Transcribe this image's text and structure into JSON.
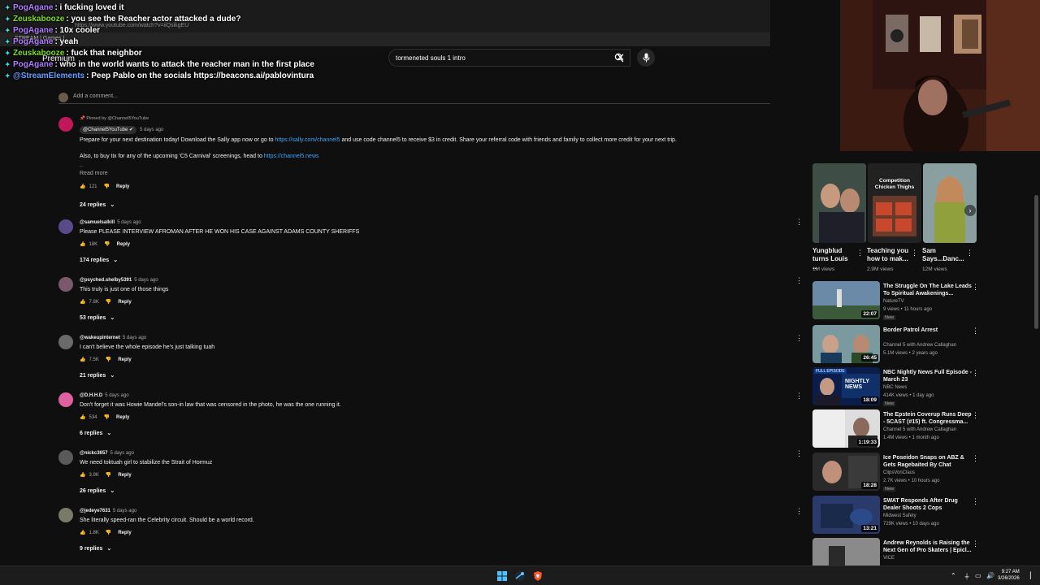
{
  "browser": {
    "url_fragment": "https://www.youtube.com/watch?v=iiQsikgEU",
    "tabs_text": "STREAM   |   Games   |"
  },
  "logo": {
    "premium_label": "Premium"
  },
  "chat": {
    "lines": [
      {
        "user": "PogAgane",
        "msg": ": i fucking loved it",
        "color": "#b07cff"
      },
      {
        "user": "Zeuskabooze",
        "msg": ": you see the Reacher actor attacked a dude?",
        "color": "#7cdc2a"
      },
      {
        "user": "PogAgane",
        "msg": ": 10x cooler",
        "color": "#b07cff"
      },
      {
        "user": "PogAgane",
        "msg": ": yeah",
        "color": "#b07cff"
      },
      {
        "user": "Zeuskabooze",
        "msg": ": fuck that neighbor",
        "color": "#7cdc2a"
      },
      {
        "user": "PogAgane",
        "msg": ": who in the world wants to attack the reacher man in the first place",
        "color": "#b07cff"
      },
      {
        "user": "@StreamElements",
        "msg": ": Peep Pablo on the socials https://beacons.ai/pablovintura",
        "color": "#6aa0ff"
      }
    ]
  },
  "search": {
    "query": "tormeneted souls 1 intro"
  },
  "comments_section": {
    "add_comment_placeholder": "Add a comment...",
    "pinned": {
      "pinned_label": "Pinned by @Channel5YouTube",
      "author": "@Channel5YouTube",
      "time": "5 days ago",
      "text_before_link": "Prepare for your next destination today! Download the Sally app now or go to ",
      "link1": "https://sally.com/channel5",
      "text_after_link": " and use code channel5 to receive $3 in credit. Share your referral code with friends and family to collect more credit for your next trip.",
      "text2_before_link": "Also, to buy tix for any of the upcoming 'C5 Carnival' screenings, head to ",
      "link2": "https://channel5.news",
      "dots": "..",
      "read_more": "Read more",
      "likes": "121",
      "reply": "Reply",
      "replies": "24 replies"
    },
    "comments": [
      {
        "author": "@samuelsalkill",
        "time": "5 days ago",
        "text": "Please PLEASE INTERVIEW AFROMAN AFTER HE WON HIS CASE AGAINST ADAMS COUNTY SHERIFFS",
        "likes": "18K",
        "reply": "Reply",
        "replies": "174 replies"
      },
      {
        "author": "@psyched.shelby5391",
        "time": "5 days ago",
        "text": "This truly is just one of those things",
        "likes": "7.8K",
        "reply": "Reply",
        "replies": "53 replies"
      },
      {
        "author": "@wakeupinternet",
        "time": "5 days ago",
        "text": "I can't believe the whole episode he's just talking tuah",
        "likes": "7.5K",
        "reply": "Reply",
        "replies": "21 replies"
      },
      {
        "author": "@D.H.H.D",
        "time": "5 days ago",
        "text": "Don't forget it was Howie Mandel's son-in law that was censored in the photo, he was the one running it.",
        "likes": "534",
        "reply": "Reply",
        "replies": "6 replies"
      },
      {
        "author": "@nickc3657",
        "time": "5 days ago",
        "text": "We need toktuah girl to stabilize the Strait of Hormuz",
        "likes": "3.9K",
        "reply": "Reply",
        "replies": "26 replies"
      },
      {
        "author": "@jedeye7631",
        "time": "5 days ago",
        "text": "She literally speed-ran the Celebrity circuit. Should be a world record.",
        "likes": "1.8K",
        "reply": "Reply",
        "replies": "9 replies"
      }
    ]
  },
  "shorts": [
    {
      "title": "Yungblud turns Louis ...",
      "views": "1M views"
    },
    {
      "title": "Teaching you how to mak...",
      "views": "2.9M views",
      "overlay": "Competition Chicken Thighs"
    },
    {
      "title": "Sam Says...Danc...",
      "views": "12M views"
    }
  ],
  "videos": [
    {
      "title": "The Struggle On The Lake Leads To Spiritual Awakenings...",
      "channel": "NatureTV",
      "meta": "9 views • 11 hours ago",
      "badge": "New",
      "duration": "22:07"
    },
    {
      "title": "Border Patrol Arrest",
      "channel": "Channel 5 with Andrew Callaghan",
      "meta": "5.1M views • 2 years ago",
      "badge": "",
      "duration": "26:45"
    },
    {
      "title": "NBC Nightly News Full Episode - March 23",
      "channel": "NBC News",
      "meta": "414K views • 1 day ago",
      "badge": "New",
      "duration": "18:09",
      "overlay_top": "FULL EPISODE",
      "overlay_main": "NIGHTLY NEWS"
    },
    {
      "title": "The Epstein Coverup Runs Deep - 5CAST (#15) ft. Congressma...",
      "channel": "Channel 5 with Andrew Callaghan",
      "meta": "1.4M views • 1 month ago",
      "badge": "",
      "duration": "1:19:33"
    },
    {
      "title": "Ice Poseidon Snaps on ABZ & Gets Ragebaited By Chat",
      "channel": "ClipsVonClaus",
      "meta": "2.7K views • 10 hours ago",
      "badge": "New",
      "duration": "18:28"
    },
    {
      "title": "SWAT Responds After Drug Dealer Shoots 2 Cops",
      "channel": "Midwest Safety",
      "meta": "729K views • 10 days ago",
      "badge": "",
      "duration": "13:21"
    },
    {
      "title": "Andrew Reynolds is Raising the Next Gen of Pro Skaters | Epicl...",
      "channel": "VICE",
      "meta": "",
      "badge": "",
      "duration": ""
    }
  ],
  "taskbar": {
    "time": "9:27 AM",
    "date": "3/26/2026"
  }
}
